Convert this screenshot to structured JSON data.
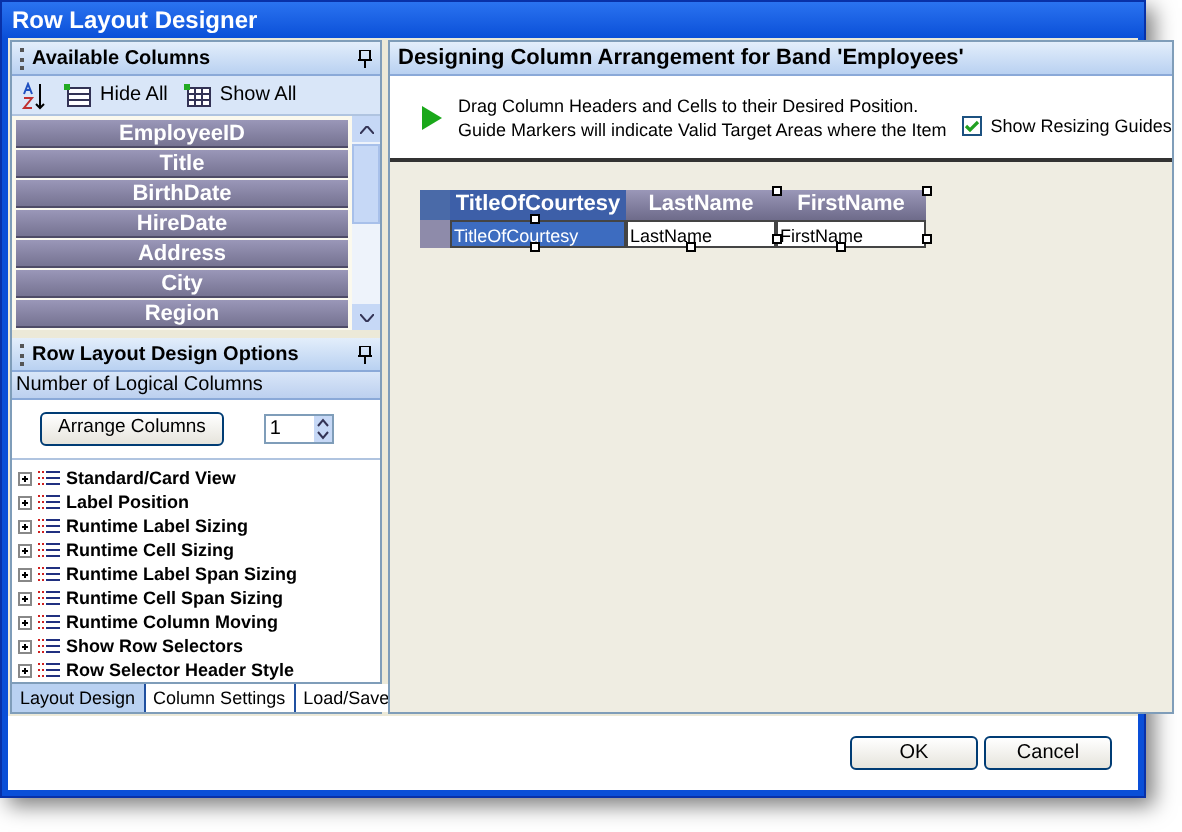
{
  "window": {
    "title": "Row Layout Designer"
  },
  "available_columns": {
    "title": "Available Columns",
    "toolbar": [
      {
        "kind": "sort"
      },
      {
        "kind": "hide",
        "label": "Hide All"
      },
      {
        "kind": "show",
        "label": "Show All"
      }
    ],
    "items": [
      "EmployeeID",
      "Title",
      "BirthDate",
      "HireDate",
      "Address",
      "City",
      "Region"
    ]
  },
  "options": {
    "title": "Row Layout Design Options",
    "section": "Number of Logical Columns",
    "arrange_button": "Arrange Columns",
    "count": "1",
    "tree": [
      {
        "label": "Standard/Card View",
        "expanded": false
      },
      {
        "label": "Label Position",
        "expanded": false
      },
      {
        "label": "Runtime Label Sizing",
        "expanded": false
      },
      {
        "label": "Runtime Cell Sizing",
        "expanded": false
      },
      {
        "label": "Runtime Label Span Sizing",
        "expanded": false
      },
      {
        "label": "Runtime Cell Span Sizing",
        "expanded": false
      },
      {
        "label": "Runtime Column Moving",
        "expanded": false
      },
      {
        "label": "Show Row Selectors",
        "expanded": false
      },
      {
        "label": "Row Selector Header Style",
        "expanded": false
      }
    ]
  },
  "tabs": [
    {
      "label": "Layout Design",
      "selected": true
    },
    {
      "label": "Column Settings",
      "selected": false
    },
    {
      "label": "Load/Save",
      "selected": false
    }
  ],
  "designer": {
    "title": "Designing Column Arrangement for Band 'Employees'",
    "instructions": [
      "Drag Column Headers and Cells to their Desired Position.",
      "Guide Markers will indicate Valid Target Areas where the Item"
    ],
    "resizing_guides": {
      "label": "Show Resizing Guides",
      "checked": true
    },
    "columns": [
      {
        "header": "TitleOfCourtesy",
        "cell": "TitleOfCourtesy",
        "selected": true
      },
      {
        "header": "LastName",
        "cell": "LastName",
        "selected": false
      },
      {
        "header": "FirstName",
        "cell": "FirstName",
        "selected": false
      }
    ]
  },
  "buttons": [
    "OK",
    "Cancel"
  ]
}
